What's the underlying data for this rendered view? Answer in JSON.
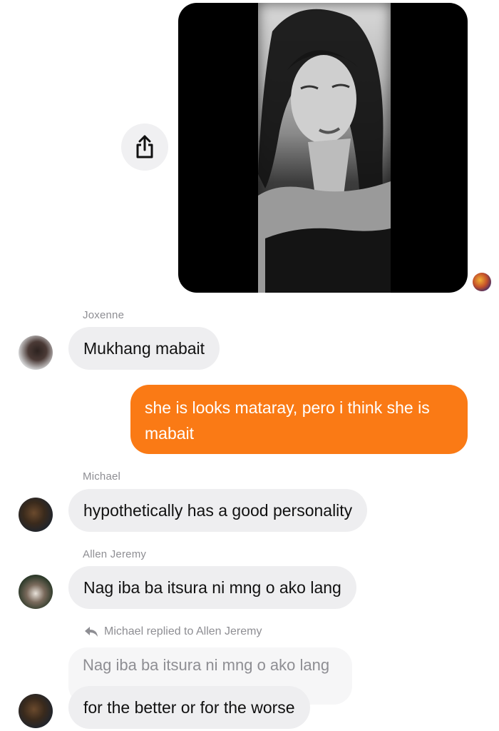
{
  "thread": {
    "share_icon": "share-icon",
    "messages": [
      {
        "sender": "Joxenne",
        "text": "Mukhang mabait"
      },
      {
        "sender": "me",
        "text": "she is looks mataray, pero i think she is mabait"
      },
      {
        "sender": "Michael",
        "text": "hypothetically has a good personality"
      },
      {
        "sender": "Allen Jeremy",
        "text": "Nag iba ba itsura ni mng o ako lang"
      },
      {
        "reply_label": "Michael replied to Allen Jeremy",
        "quoted_text": "Nag iba ba itsura ni mng o ako lang",
        "text": "for the better or for the worse"
      }
    ]
  },
  "colors": {
    "outgoing_bubble": "#fa7a15",
    "incoming_bubble": "#eeeef0",
    "secondary_text": "#8e8e93"
  }
}
